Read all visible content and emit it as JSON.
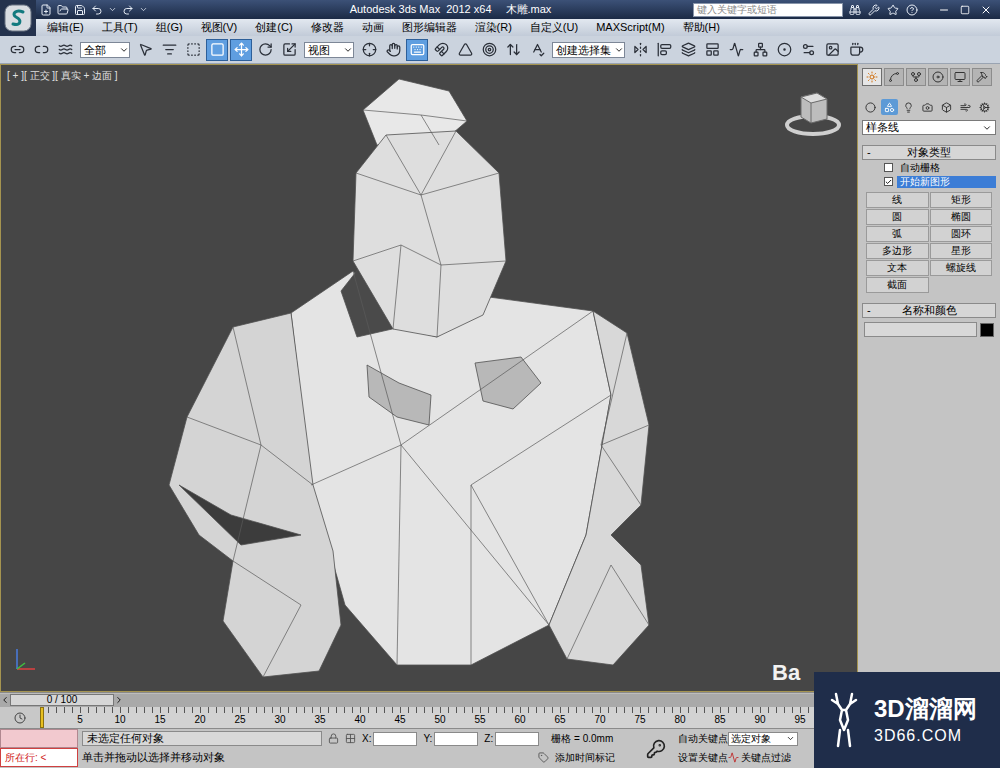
{
  "title_bar": {
    "title": "Autodesk 3ds Max  2012 x64",
    "file_name": "木雕.max",
    "search_placeholder": "键入关键字或短语"
  },
  "menu": [
    "编辑(E)",
    "工具(T)",
    "组(G)",
    "视图(V)",
    "创建(C)",
    "修改器",
    "动画",
    "图形编辑器",
    "渲染(R)",
    "自定义(U)",
    "MAXScript(M)",
    "帮助(H)"
  ],
  "toolbar": [
    {
      "kind": "icon",
      "selected": false
    },
    {
      "kind": "icon",
      "selected": false
    },
    {
      "kind": "icon",
      "selected": false
    },
    {
      "kind": "dropdown",
      "value": "全部"
    },
    {
      "kind": "icon",
      "selected": false
    },
    {
      "kind": "icon",
      "selected": false
    },
    {
      "kind": "icon",
      "selected": false
    },
    {
      "kind": "icon",
      "selected": true
    },
    {
      "kind": "icon",
      "selected": true
    },
    {
      "kind": "icon",
      "selected": false
    },
    {
      "kind": "icon",
      "selected": false
    },
    {
      "kind": "dropdown",
      "value": "视图"
    },
    {
      "kind": "icon",
      "selected": false
    },
    {
      "kind": "icon",
      "selected": false
    },
    {
      "kind": "icon",
      "selected": true
    },
    {
      "kind": "icon",
      "selected": false
    },
    {
      "kind": "icon",
      "selected": false
    },
    {
      "kind": "icon",
      "selected": false
    },
    {
      "kind": "icon",
      "selected": false
    },
    {
      "kind": "icon",
      "selected": false
    },
    {
      "kind": "dropdown",
      "value": "创建选择集"
    },
    {
      "kind": "icon",
      "selected": false
    },
    {
      "kind": "icon",
      "selected": false
    },
    {
      "kind": "icon",
      "selected": false
    },
    {
      "kind": "icon",
      "selected": false
    },
    {
      "kind": "icon",
      "selected": false
    },
    {
      "kind": "icon",
      "selected": false
    },
    {
      "kind": "icon",
      "selected": false
    },
    {
      "kind": "icon",
      "selected": false
    },
    {
      "kind": "icon",
      "selected": false
    },
    {
      "kind": "icon",
      "selected": false
    }
  ],
  "viewport": {
    "label": "[ + ][ 正交 ][ 真实 + 边面 ]"
  },
  "command_panel": {
    "tabs": [
      {
        "selected": true
      },
      {
        "selected": false
      },
      {
        "selected": false
      },
      {
        "selected": false
      },
      {
        "selected": false
      },
      {
        "selected": false
      }
    ],
    "subtabs": [
      {
        "selected": false
      },
      {
        "selected": true
      },
      {
        "selected": false
      },
      {
        "selected": false
      },
      {
        "selected": false
      },
      {
        "selected": false
      },
      {
        "selected": false
      }
    ],
    "category": "样条线",
    "object_type": {
      "toggle": "-",
      "title": "对象类型",
      "options": [
        {
          "label": "自动栅格",
          "checked": false,
          "selected": false
        },
        {
          "label": "开始新图形",
          "checked": true,
          "selected": true
        }
      ],
      "buttons": [
        "线",
        "矩形",
        "圆",
        "椭圆",
        "弧",
        "圆环",
        "多边形",
        "星形",
        "文本",
        "螺旋线",
        "截面"
      ]
    },
    "name_color": {
      "toggle": "-",
      "title": "名称和颜色",
      "name": "",
      "color": "#000000"
    }
  },
  "timeline": {
    "frame": "0 / 100",
    "level": 0,
    "ticks": [
      "5",
      "10",
      "15",
      "20",
      "25",
      "30",
      "35",
      "40",
      "45",
      "50",
      "55",
      "60",
      "65",
      "70",
      "75",
      "80",
      "85",
      "90",
      "95"
    ]
  },
  "status_bar": {
    "listener_prompt": "所在行: <",
    "selection": "未选定任何对象",
    "prompt": "单击并拖动以选择并移动对象",
    "coords": [
      {
        "label": "X:",
        "value": ""
      },
      {
        "label": "Y:",
        "value": ""
      },
      {
        "label": "Z:",
        "value": ""
      }
    ],
    "grid": "栅格 = 0.0mm",
    "add_time_tag": "添加时间标记",
    "auto_key": "自动关键点",
    "key_mode": "选定对象",
    "set_key": "设置关键点",
    "key_filters": "关键点过滤"
  },
  "watermark": {
    "brand": "3D溜溜网",
    "site": "3D66.COM",
    "baidu": "Ba"
  }
}
